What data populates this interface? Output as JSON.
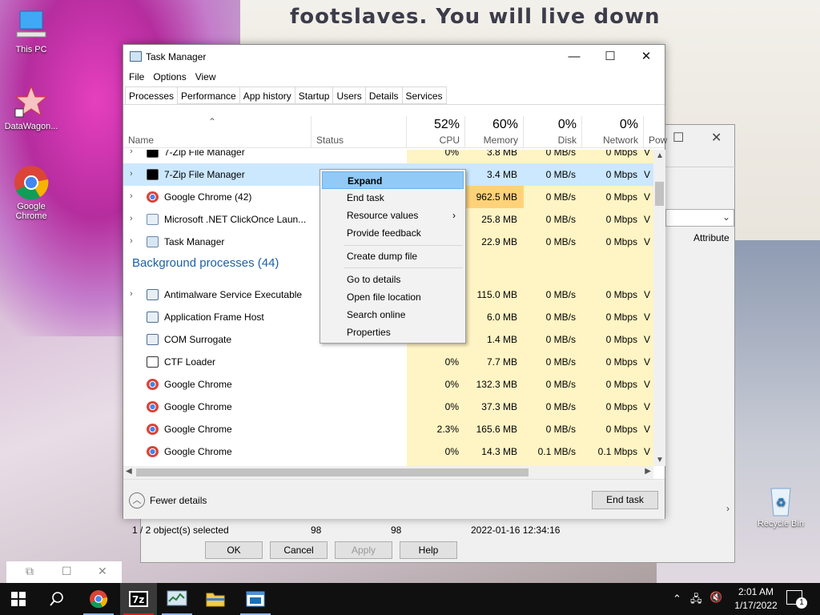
{
  "desktop": {
    "wallpaper_text": "footslaves. You will live down",
    "icons": [
      {
        "label": "This PC"
      },
      {
        "label": "DataWagon..."
      },
      {
        "label": "Google Chrome"
      },
      {
        "label": "Recycle Bin"
      }
    ]
  },
  "bg_window": {
    "attribute_label": "Attribute",
    "buttons": {
      "ok": "OK",
      "cancel": "Cancel",
      "apply": "Apply",
      "help": "Help"
    }
  },
  "task_manager": {
    "title": "Task Manager",
    "menu": [
      "File",
      "Options",
      "View"
    ],
    "tabs": [
      "Processes",
      "Performance",
      "App history",
      "Startup",
      "Users",
      "Details",
      "Services"
    ],
    "columns": {
      "name": "Name",
      "status": "Status",
      "cpu": {
        "pct": "52%",
        "label": "CPU"
      },
      "memory": {
        "pct": "60%",
        "label": "Memory"
      },
      "disk": {
        "pct": "0%",
        "label": "Disk"
      },
      "network": {
        "pct": "0%",
        "label": "Network"
      },
      "power": "Pow"
    },
    "group_background": "Background processes (44)",
    "rows": [
      {
        "name": "7-Zip File Manager",
        "cpu": "0%",
        "memory": "3.8 MB",
        "disk": "0 MB/s",
        "network": "0 Mbps",
        "power": "V",
        "icon": "7zip-icon"
      },
      {
        "name": "7-Zip File Manager",
        "cpu": "",
        "memory": "3.4 MB",
        "disk": "0 MB/s",
        "network": "0 Mbps",
        "power": "V",
        "icon": "7zip-icon"
      },
      {
        "name": "Google Chrome (42)",
        "cpu": "",
        "memory": "962.5 MB",
        "disk": "0 MB/s",
        "network": "0 Mbps",
        "power": "V",
        "icon": "chrome-icon"
      },
      {
        "name": "Microsoft .NET ClickOnce Laun...",
        "cpu": "",
        "memory": "25.8 MB",
        "disk": "0 MB/s",
        "network": "0 Mbps",
        "power": "V",
        "icon": "dotnet-icon"
      },
      {
        "name": "Task Manager",
        "cpu": "",
        "memory": "22.9 MB",
        "disk": "0 MB/s",
        "network": "0 Mbps",
        "power": "V",
        "icon": "taskmanager-icon"
      },
      {
        "name": "Antimalware Service Executable",
        "cpu": "",
        "memory": "115.0 MB",
        "disk": "0 MB/s",
        "network": "0 Mbps",
        "power": "V",
        "icon": "service-icon"
      },
      {
        "name": "Application Frame Host",
        "cpu": "",
        "memory": "6.0 MB",
        "disk": "0 MB/s",
        "network": "0 Mbps",
        "power": "V",
        "icon": "service-icon"
      },
      {
        "name": "COM Surrogate",
        "cpu": "0%",
        "memory": "1.4 MB",
        "disk": "0 MB/s",
        "network": "0 Mbps",
        "power": "V",
        "icon": "service-icon"
      },
      {
        "name": "CTF Loader",
        "cpu": "0%",
        "memory": "7.7 MB",
        "disk": "0 MB/s",
        "network": "0 Mbps",
        "power": "V",
        "icon": "ctf-icon"
      },
      {
        "name": "Google Chrome",
        "cpu": "0%",
        "memory": "132.3 MB",
        "disk": "0 MB/s",
        "network": "0 Mbps",
        "power": "V",
        "icon": "chrome-icon"
      },
      {
        "name": "Google Chrome",
        "cpu": "0%",
        "memory": "37.3 MB",
        "disk": "0 MB/s",
        "network": "0 Mbps",
        "power": "V",
        "icon": "chrome-icon"
      },
      {
        "name": "Google Chrome",
        "cpu": "2.3%",
        "memory": "165.6 MB",
        "disk": "0 MB/s",
        "network": "0 Mbps",
        "power": "V",
        "icon": "chrome-icon"
      },
      {
        "name": "Google Chrome",
        "cpu": "0%",
        "memory": "14.3 MB",
        "disk": "0.1 MB/s",
        "network": "0.1 Mbps",
        "power": "V",
        "icon": "chrome-icon"
      }
    ],
    "footer": {
      "fewer_details": "Fewer details",
      "end_task": "End task"
    }
  },
  "context_menu": {
    "items": [
      "Expand",
      "End task",
      "Resource values",
      "Provide feedback",
      "Create dump file",
      "Go to details",
      "Open file location",
      "Search online",
      "Properties"
    ]
  },
  "statusbar": {
    "selected": "1 / 2 object(s) selected",
    "col2": "98",
    "col3": "98",
    "date": "2022-01-16 12:34:16"
  },
  "taskbar": {
    "time": "2:01 AM",
    "date": "1/17/2022",
    "notification_count": "1"
  },
  "colors": {
    "accent": "#0078d7",
    "selection": "#cce8ff",
    "heat_light": "#fff4c4",
    "heat_strong": "#ffd27a"
  }
}
